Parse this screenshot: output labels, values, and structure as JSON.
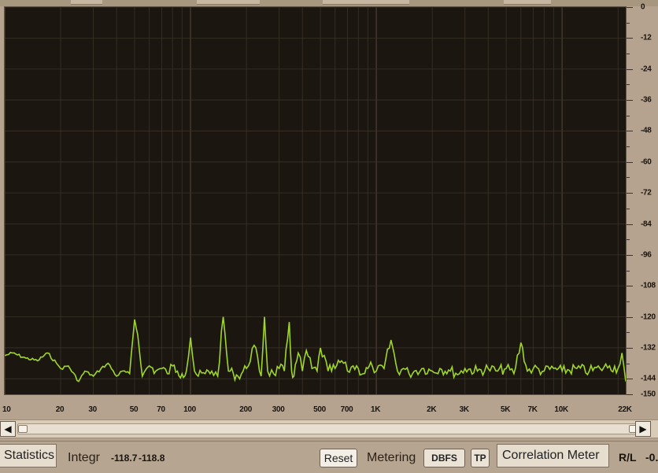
{
  "spectrum": {
    "y_axis_labels": [
      "0",
      "-12",
      "-24",
      "-36",
      "-48",
      "-60",
      "-72",
      "-84",
      "-96",
      "-108",
      "-120",
      "-132",
      "-144",
      "-150"
    ],
    "x_axis_labels": [
      "10",
      "20",
      "30",
      "50",
      "70",
      "100",
      "200",
      "300",
      "500",
      "700",
      "1K",
      "2K",
      "3K",
      "5K",
      "7K",
      "10K",
      "22K"
    ],
    "trace_color": "#9fd62a",
    "background_color": "#1b1610"
  },
  "chart_data": {
    "type": "line",
    "x_scale": "log",
    "xlim": [
      10,
      22000
    ],
    "ylim": [
      -150,
      0
    ],
    "x": [
      10,
      11,
      13,
      15,
      17,
      19,
      20,
      22,
      25,
      27,
      30,
      33,
      36,
      40,
      43,
      47,
      50,
      52,
      55,
      58,
      60,
      65,
      70,
      75,
      80,
      85,
      90,
      95,
      100,
      105,
      110,
      120,
      130,
      140,
      150,
      160,
      170,
      180,
      200,
      220,
      240,
      250,
      260,
      280,
      300,
      320,
      340,
      350,
      360,
      380,
      400,
      420,
      450,
      480,
      500,
      550,
      600,
      650,
      700,
      750,
      800,
      850,
      900,
      950,
      1000,
      1100,
      1200,
      1300,
      1400,
      1500,
      1600,
      1800,
      2000,
      2200,
      2500,
      2800,
      3000,
      3500,
      4000,
      4500,
      5000,
      5500,
      6000,
      6500,
      7000,
      8000,
      9000,
      10000,
      12000,
      14000,
      16000,
      18000,
      20000,
      21000,
      22000
    ],
    "y": [
      -135,
      -134,
      -136,
      -137,
      -134,
      -138,
      -140,
      -139,
      -145,
      -141,
      -143,
      -140,
      -138,
      -143,
      -141,
      -142,
      -121,
      -127,
      -143,
      -140,
      -139,
      -141,
      -140,
      -142,
      -139,
      -141,
      -142,
      -141,
      -128,
      -141,
      -143,
      -142,
      -141,
      -143,
      -120,
      -141,
      -142,
      -143,
      -140,
      -131,
      -143,
      -120,
      -141,
      -142,
      -140,
      -141,
      -122,
      -141,
      -143,
      -134,
      -141,
      -133,
      -140,
      -141,
      -132,
      -141,
      -140,
      -137,
      -141,
      -139,
      -140,
      -142,
      -140,
      -139,
      -141,
      -140,
      -129,
      -141,
      -140,
      -142,
      -141,
      -140,
      -141,
      -140,
      -141,
      -142,
      -140,
      -141,
      -140,
      -141,
      -140,
      -142,
      -130,
      -141,
      -140,
      -141,
      -140,
      -141,
      -140,
      -141,
      -140,
      -139,
      -140,
      -134,
      -145
    ]
  },
  "scrollbar": {
    "left_arrow": "◀",
    "right_arrow": "▶"
  },
  "bottom": {
    "statistics_tab": "Statistics",
    "integr_label": "Integr",
    "integr_left": "-118.7",
    "integr_right": "-118.8",
    "reset_button": "Reset",
    "metering_label": "Metering",
    "dbfs_button": "DBFS",
    "tp_button": "TP",
    "correlation_tab": "Correlation Meter",
    "rl_label": "R/L",
    "rl_value": "-0."
  }
}
